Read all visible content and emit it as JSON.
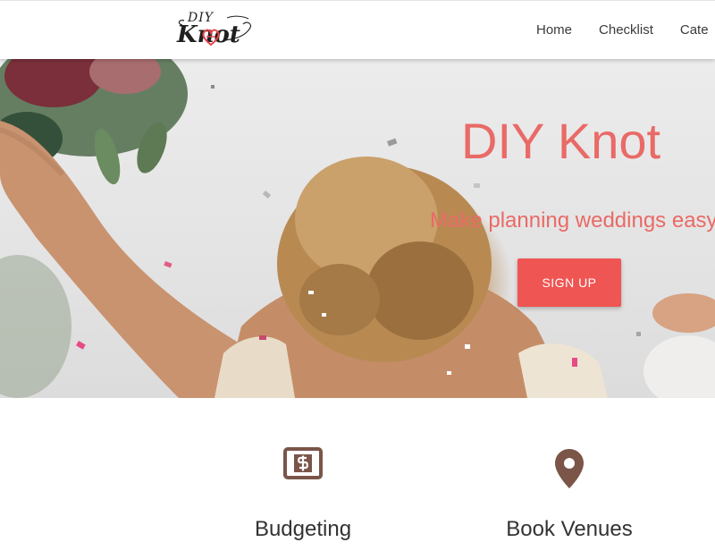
{
  "brand": {
    "logo_top": "DIY",
    "logo_main": "Knot"
  },
  "nav": {
    "items": [
      {
        "label": "Home"
      },
      {
        "label": "Checklist"
      },
      {
        "label": "Cate"
      }
    ]
  },
  "hero": {
    "title": "DIY Knot",
    "tagline": "Make planning weddings easy.",
    "cta_label": "SIGN UP"
  },
  "features": [
    {
      "label": "Budgeting",
      "icon": "dollar-bill-icon"
    },
    {
      "label": "Book Venues",
      "icon": "map-pin-icon"
    }
  ],
  "colors": {
    "accent": "#e96a66",
    "button": "#ef5552",
    "icon": "#7a5548"
  }
}
